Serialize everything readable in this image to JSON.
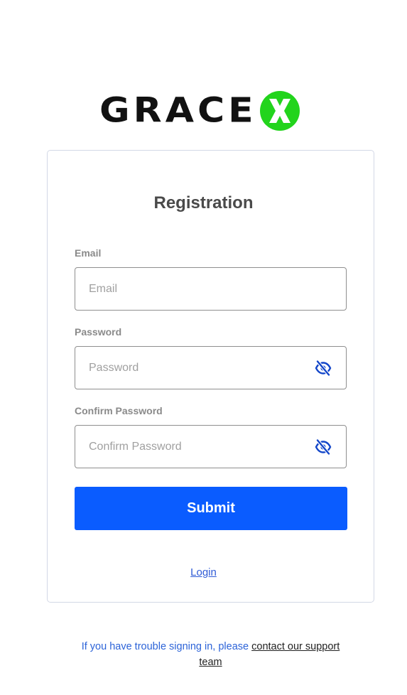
{
  "brand": {
    "logo_text": "GRACE",
    "logo_accent_letter": "X",
    "logo_color": "#111111",
    "accent_color": "#22d41c"
  },
  "form": {
    "title": "Registration",
    "email": {
      "label": "Email",
      "placeholder": "Email",
      "value": ""
    },
    "password": {
      "label": "Password",
      "placeholder": "Password",
      "value": "",
      "toggle_icon": "eye-off-icon"
    },
    "confirm_password": {
      "label": "Confirm Password",
      "placeholder": "Confirm Password",
      "value": "",
      "toggle_icon": "eye-off-icon"
    },
    "submit_label": "Submit",
    "login_link": "Login"
  },
  "help": {
    "prefix": "If you have trouble signing in, please ",
    "link": "contact our support team"
  },
  "colors": {
    "primary": "#0a5cff",
    "icon": "#1346c9",
    "link": "#2c63d8",
    "border": "#d3d8e6"
  }
}
